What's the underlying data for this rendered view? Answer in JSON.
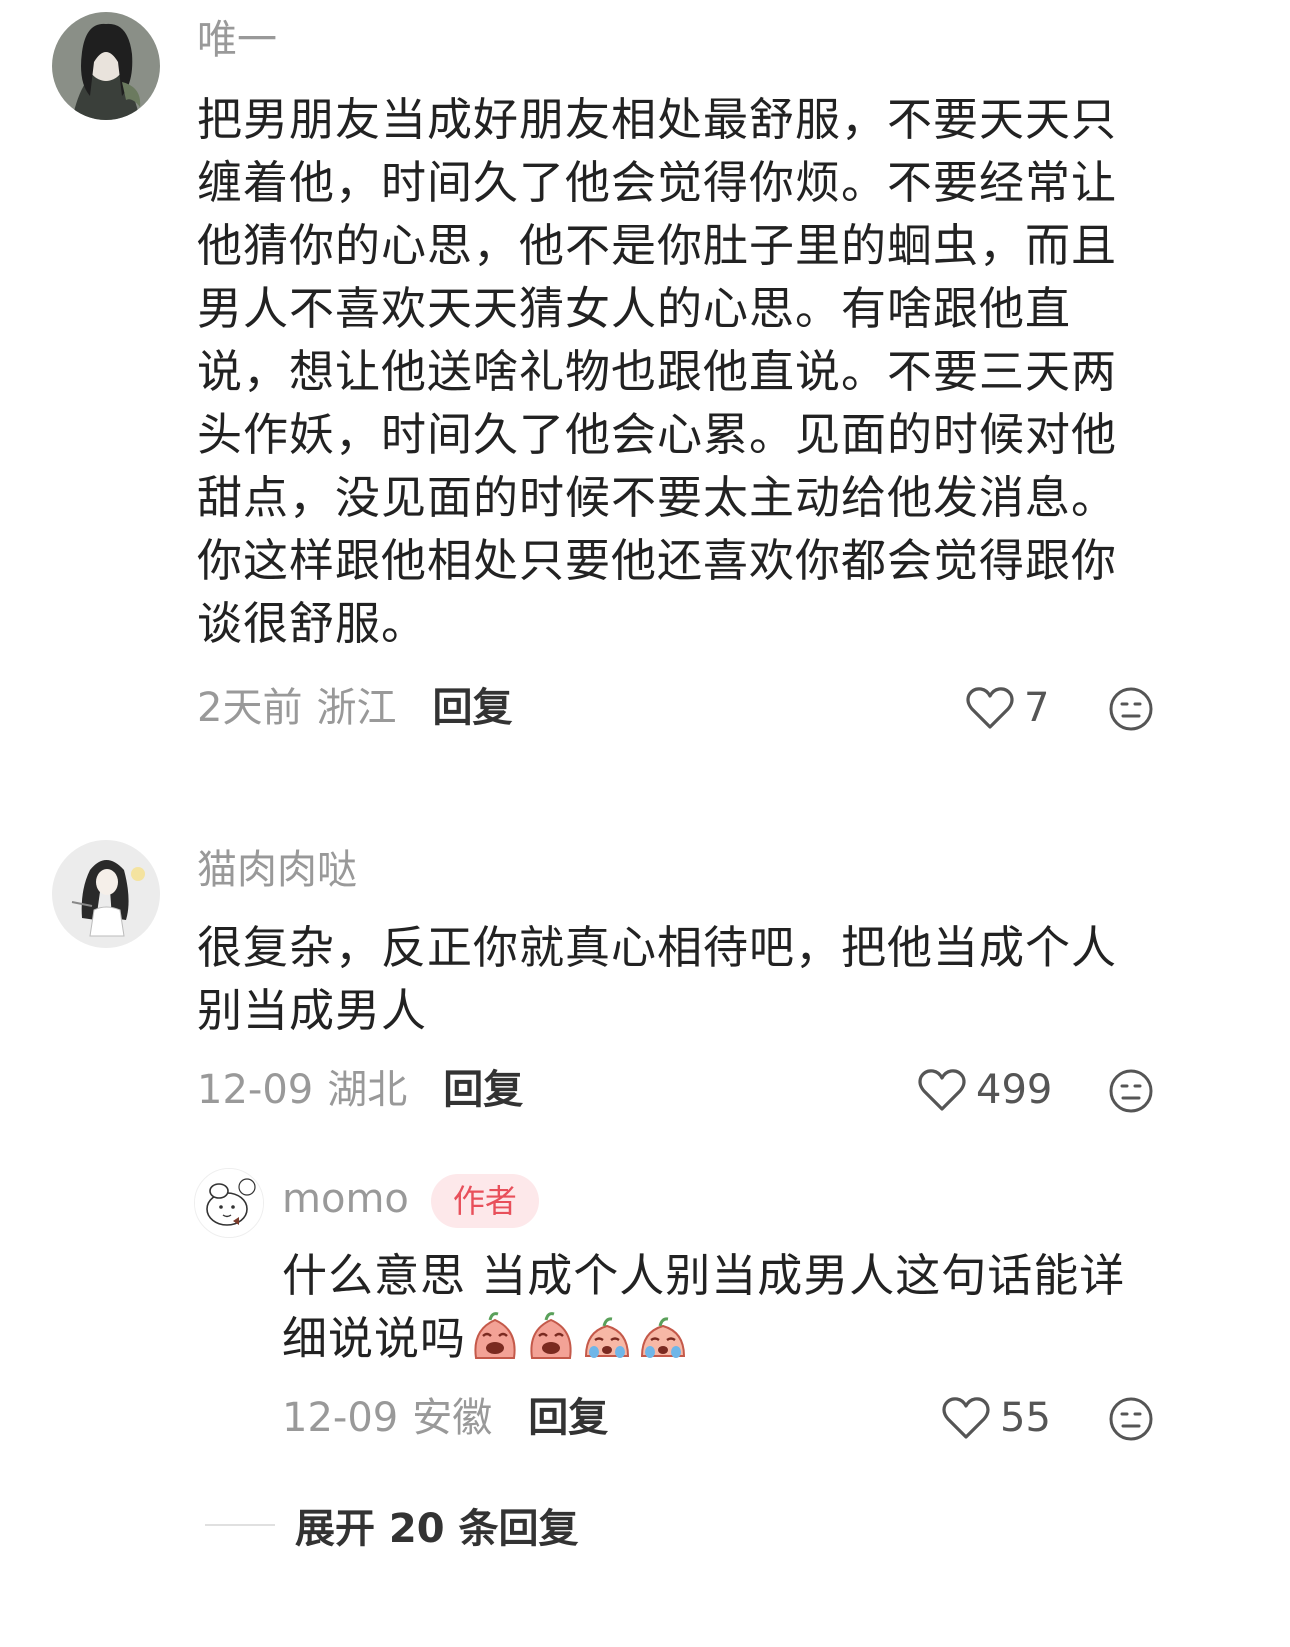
{
  "comments": [
    {
      "username": "唯一",
      "lines": [
        "把男朋友当成好朋友相处最舒服，不要天天只",
        "缠着他，时间久了他会觉得你烦。不要经常让",
        "他猜你的心思，他不是你肚子里的蛔虫，而且",
        "男人不喜欢天天猜女人的心思。有啥跟他直",
        "说，想让他送啥礼物也跟他直说。不要三天两",
        "头作妖，时间久了他会心累。见面的时候对他",
        "甜点，没见面的时候不要太主动给他发消息。",
        "你这样跟他相处只要他还喜欢你都会觉得跟你",
        "谈很舒服。"
      ],
      "time": "2天前",
      "location": "浙江",
      "reply_label": "回复",
      "likes": "7"
    },
    {
      "username": "猫肉肉哒",
      "lines": [
        "很复杂，反正你就真心相待吧，把他当成个人",
        "别当成男人"
      ],
      "time": "12-09",
      "location": "湖北",
      "reply_label": "回复",
      "likes": "499"
    }
  ],
  "reply": {
    "username": "momo",
    "badge": "作者",
    "lines": [
      "什么意思 当成个人别当成男人这句话能详",
      "细说说吗"
    ],
    "emojis": [
      "crying-emoji",
      "crying-emoji",
      "sobbing-emoji",
      "sobbing-emoji"
    ],
    "time": "12-09",
    "location": "安徽",
    "reply_label": "回复",
    "likes": "55"
  },
  "expand_label": "展开 20 条回复",
  "colors": {
    "text": "#222222",
    "muted": "#999999",
    "badge_bg": "#fde8ea",
    "badge_text": "#e8505b"
  }
}
